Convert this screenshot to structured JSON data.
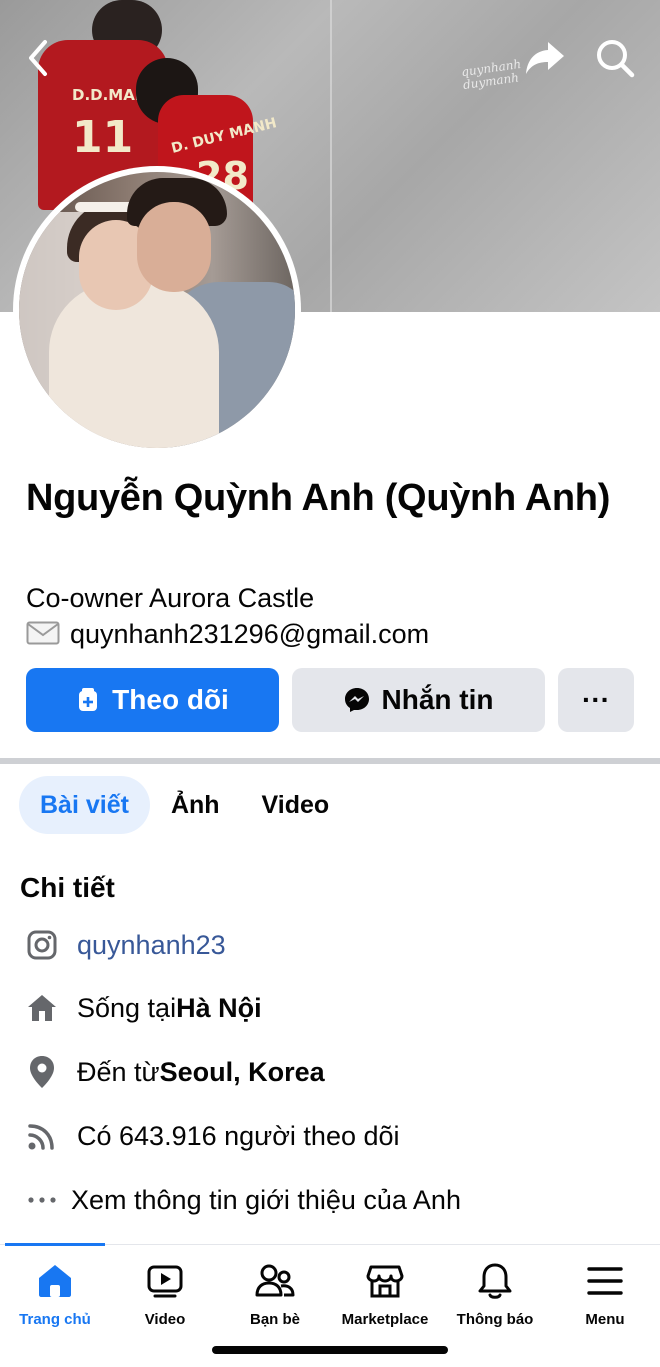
{
  "header": {
    "back_icon": "chevron-left-icon",
    "share_icon": "share-icon",
    "search_icon": "search-icon",
    "cover_jersey_text_1": "D.D.MANH",
    "cover_jersey_number_1": "11",
    "cover_jersey_text_2": "D. DUY MANH",
    "cover_jersey_number_2": "28",
    "cover_signature_1": "quynhanh",
    "cover_signature_2": "duymanh"
  },
  "profile": {
    "name": "Nguyễn Quỳnh Anh (Quỳnh Anh)",
    "bio_line_1": "Co-owner Aurora Castle",
    "bio_line_2": "quynhanh231296@gmail.com",
    "bio_line_2_icon": "envelope-icon"
  },
  "actions": {
    "follow_label": "Theo dõi",
    "message_label": "Nhắn tin",
    "more_label": "···"
  },
  "tabs": [
    {
      "label": "Bài viết",
      "active": true
    },
    {
      "label": "Ảnh",
      "active": false
    },
    {
      "label": "Video",
      "active": false
    }
  ],
  "details": {
    "title": "Chi tiết",
    "instagram": "quynhanh23",
    "lives_prefix": "Sống tại ",
    "lives_city": "Hà Nội",
    "from_prefix": "Đến từ ",
    "from_city": "Seoul, Korea",
    "followers_text": "Có 643.916 người theo dõi",
    "see_more": "Xem thông tin giới thiệu của Anh"
  },
  "bottom_nav": [
    {
      "label": "Trang chủ",
      "icon": "home-icon",
      "active": true
    },
    {
      "label": "Video",
      "icon": "video-icon",
      "active": false
    },
    {
      "label": "Bạn bè",
      "icon": "friends-icon",
      "active": false
    },
    {
      "label": "Marketplace",
      "icon": "marketplace-icon",
      "active": false
    },
    {
      "label": "Thông báo",
      "icon": "bell-icon",
      "active": false
    },
    {
      "label": "Menu",
      "icon": "menu-icon",
      "active": false
    }
  ],
  "colors": {
    "accent": "#1877f2",
    "secondary_button": "#e4e6eb",
    "active_tab_bg": "#e7f0fd",
    "link": "#385898",
    "text": "#050505"
  }
}
